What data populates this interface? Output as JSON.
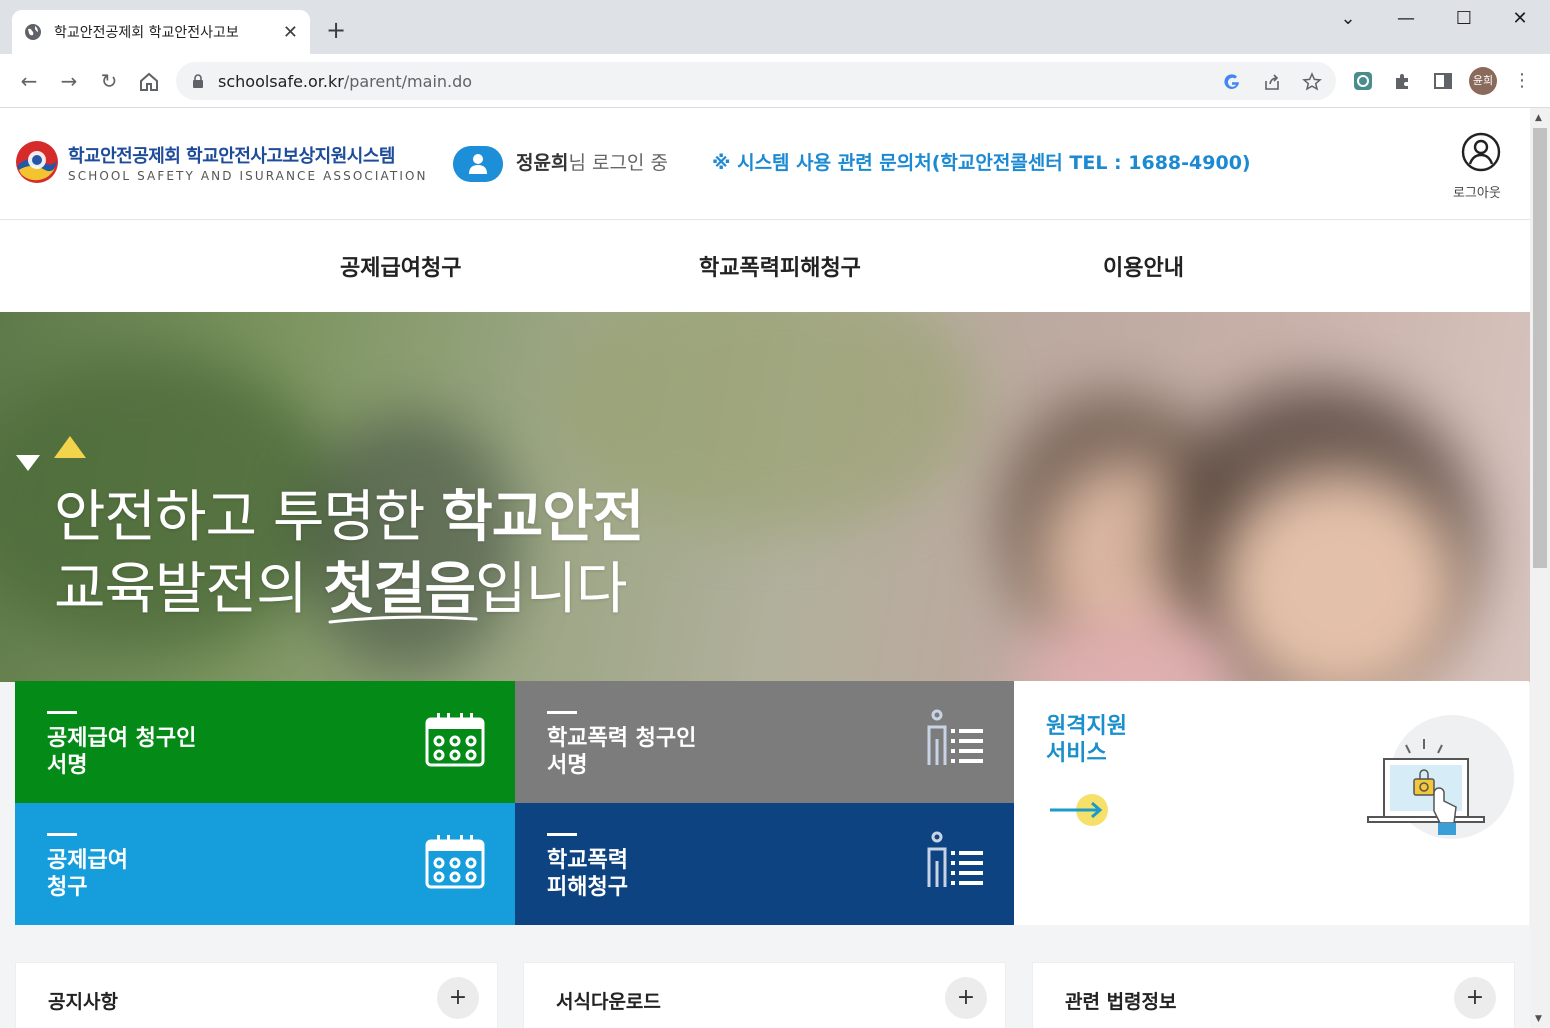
{
  "browser": {
    "tab_title": "학교안전공제회 학교안전사고보",
    "tab_close": "✕",
    "new_tab": "+",
    "url_host": "schoolsafe.or.kr",
    "url_path": "/parent/main.do",
    "profile_label": "윤희",
    "window": {
      "minimize": "—",
      "maximize": "☐",
      "close": "✕",
      "menu": "⌄"
    }
  },
  "header": {
    "logo_kr": "학교안전공제회 학교안전사고보상지원시스템",
    "logo_en": "SCHOOL SAFETY AND ISURANCE ASSOCIATION",
    "user_name": "정윤희",
    "user_suffix": "님 로그인 중",
    "helpdesk": "※ 시스템 사용 관련 문의처(학교안전콜센터 TEL : 1688-4900)",
    "logout": "로그아웃"
  },
  "gnb": {
    "items": [
      "공제급여청구",
      "학교폭력피해청구",
      "이용안내"
    ]
  },
  "hero": {
    "line1_light": "안전하고 투명한 ",
    "line1_bold": "학교안전",
    "line2_light_a": "교육발전의 ",
    "line2_bold": "첫걸음",
    "line2_light_b": "입니다"
  },
  "tiles": {
    "t1": {
      "line1": "공제급여 청구인",
      "line2": "서명",
      "color": "#038a17"
    },
    "t2": {
      "line1": "학교폭력 청구인",
      "line2": "서명",
      "color": "#7c7c7c"
    },
    "t3": {
      "line1": "공제급여",
      "line2": "청구",
      "color": "#169edc"
    },
    "t4": {
      "line1": "학교폭력",
      "line2": "피해청구",
      "color": "#0e4381"
    },
    "remote": {
      "line1": "원격지원",
      "line2": "서비스"
    }
  },
  "boards": [
    "공지사항",
    "서식다운로드",
    "관련 법령정보"
  ],
  "board_plus": "+"
}
